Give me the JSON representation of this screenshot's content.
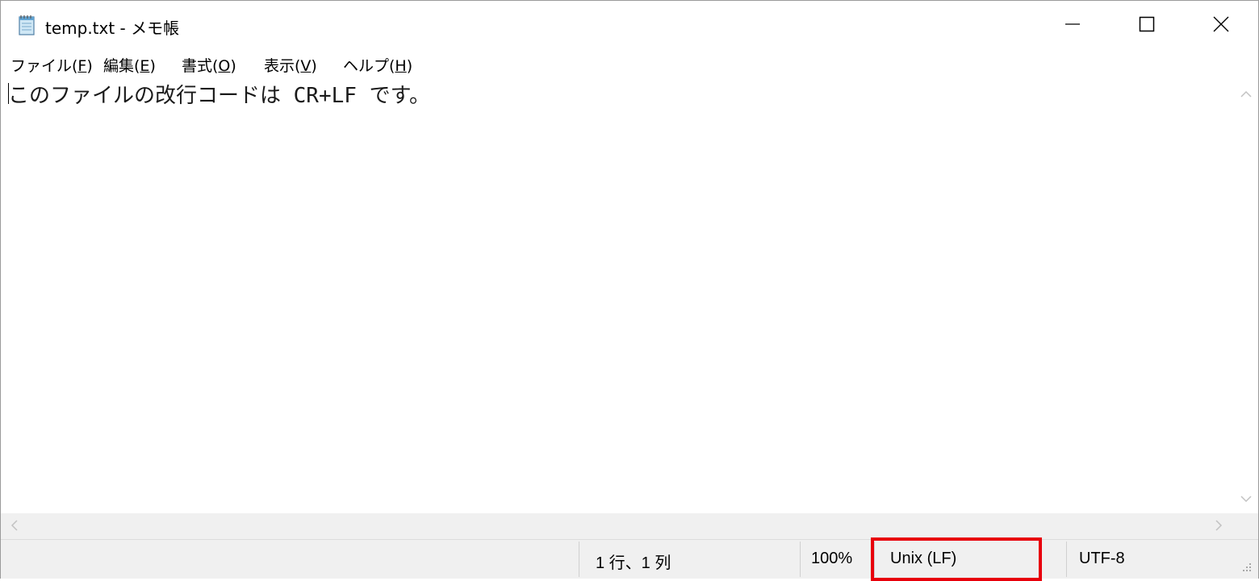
{
  "window": {
    "title": "temp.txt - メモ帳"
  },
  "menu": {
    "items": [
      {
        "label": "ファイル(",
        "key": "F",
        "close": ")"
      },
      {
        "label": "編集(",
        "key": "E",
        "close": ")"
      },
      {
        "label": "書式(",
        "key": "O",
        "close": ")"
      },
      {
        "label": "表示(",
        "key": "V",
        "close": ")"
      },
      {
        "label": "ヘルプ(",
        "key": "H",
        "close": ")"
      }
    ]
  },
  "editor": {
    "content": "このファイルの改行コードは CR+LF です。"
  },
  "status": {
    "position": "1 行、1 列",
    "zoom": "100%",
    "line_ending": "Unix (LF)",
    "encoding": "UTF-8"
  },
  "colors": {
    "highlight": "#e8000b",
    "statusbar_bg": "#f0f0f0"
  },
  "icons": {
    "app": "notepad-icon",
    "minimize": "minimize-icon",
    "maximize": "maximize-icon",
    "close": "close-icon"
  }
}
